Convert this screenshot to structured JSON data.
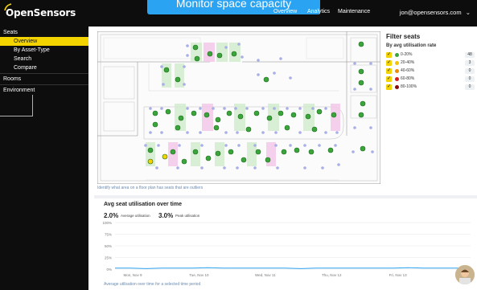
{
  "app": {
    "brand": "OpenSensors"
  },
  "banner": {
    "text": "Monitor space capacity"
  },
  "topnav": {
    "items": [
      "Overview",
      "Analytics",
      "Maintenance"
    ]
  },
  "user": {
    "email": "jon@opensensors.com",
    "menu_icon": "chevron-down-icon"
  },
  "sidebar": {
    "items": [
      {
        "label": "Seats",
        "level": 0,
        "active": false
      },
      {
        "label": "Overview",
        "level": 1,
        "active": true
      },
      {
        "label": "By Asset-Type",
        "level": 1,
        "active": false
      },
      {
        "label": "Search",
        "level": 1,
        "active": false
      },
      {
        "label": "Compare",
        "level": 1,
        "active": false
      },
      {
        "label": "Rooms",
        "level": 0,
        "active": false
      },
      {
        "label": "Environment",
        "level": 0,
        "active": false
      }
    ]
  },
  "floorplan": {
    "caption": "Identify what area on a floor plan has seats that are outliers",
    "seat_colors": {
      "green": "#3aa53a",
      "yellow": "#f3d400",
      "zone_green": "#cfeccc",
      "zone_pink": "#f2c6e8",
      "idle": "#a8aee8"
    }
  },
  "filter": {
    "title": "Filter seats",
    "subtitle": "By avg utilisation rate",
    "rows": [
      {
        "label": "0-20%",
        "count": "48",
        "color": "#3aa53a"
      },
      {
        "label": "20-40%",
        "count": "3",
        "color": "#f3c200"
      },
      {
        "label": "40-60%",
        "count": "0",
        "color": "#f08a00"
      },
      {
        "label": "60-80%",
        "count": "0",
        "color": "#d81c1c"
      },
      {
        "label": "80-100%",
        "count": "0",
        "color": "#8a0a0a"
      }
    ]
  },
  "chart": {
    "title": "Avg seat utilisation over time",
    "avg_value": "2.0%",
    "avg_label": "Average utilisation",
    "peak_value": "3.0%",
    "peak_label": "Peak utilisation",
    "caption": "Average utilisation over time for a selected time period"
  },
  "chart_data": {
    "type": "line",
    "title": "Avg seat utilisation over time",
    "y_ticks": [
      "100%",
      "75%",
      "50%",
      "25%",
      "0%"
    ],
    "ylim": [
      0,
      100
    ],
    "x_ticks": [
      "Mon, Nov 9",
      "Tue, Nov 10",
      "Wed, Nov 11",
      "Thu, Nov 12",
      "Fri, Nov 13",
      "Fri, Nov 13"
    ],
    "series": [
      {
        "values": [
          2,
          2,
          1,
          2,
          2,
          2,
          3,
          2,
          2,
          2,
          2,
          2,
          1,
          2,
          2,
          2,
          2,
          2,
          2,
          3,
          2,
          2,
          2,
          2
        ],
        "color": "#2aa3f2"
      }
    ],
    "grid": true
  }
}
